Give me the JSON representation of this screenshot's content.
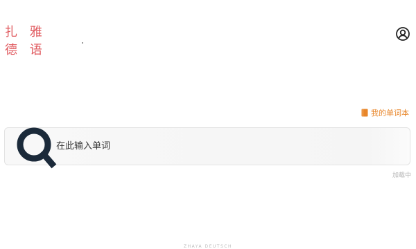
{
  "brand": {
    "line1": "扎 雅",
    "line2": "德 语",
    "color": "#e0595e"
  },
  "header": {
    "account_icon": "user-circle-icon"
  },
  "vocab_link": {
    "label": "我的单词本",
    "icon": "book-icon",
    "color": "#e8862a"
  },
  "search": {
    "placeholder": "在此输入单词",
    "value": "",
    "icon": "search-icon",
    "icon_color": "#1b2a3a"
  },
  "status": {
    "loading": "加载中"
  },
  "footer": {
    "text": "ZHAYA DEUTSCH"
  }
}
